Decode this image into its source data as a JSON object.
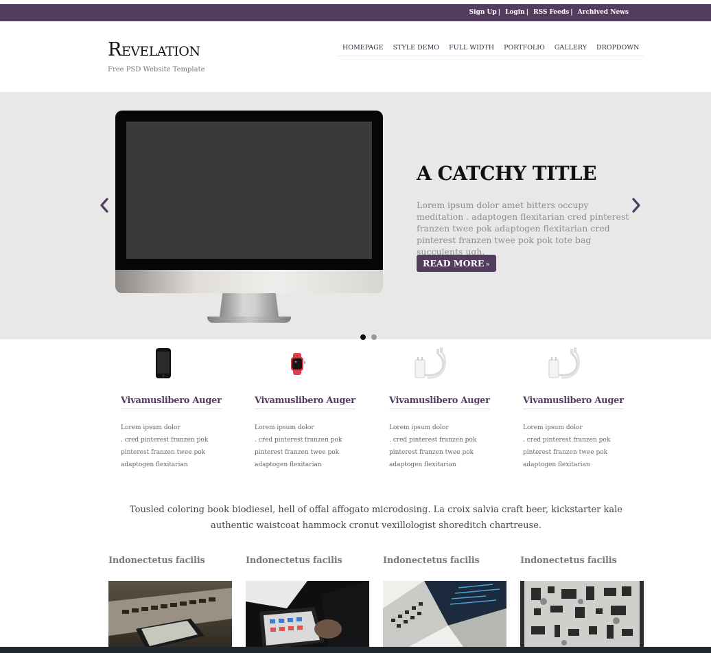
{
  "topbar": {
    "links": [
      "Sign Up",
      "Login",
      "RSS Feeds",
      "Archived News"
    ],
    "separator": "|",
    "bg_color": "#523d5e"
  },
  "header": {
    "logo": "Revelation",
    "tagline": "Free PSD Website Template"
  },
  "nav": {
    "items": [
      "HOMEPAGE",
      "STYLE DEMO",
      "FULL WIDTH",
      "PORTFOLIO",
      "GALLERY",
      "DROPDOWN"
    ]
  },
  "hero": {
    "title": "A CATCHY TITLE",
    "text": "Lorem ipsum dolor amet bitters occupy meditation . adaptogen flexitarian cred pinterest franzen twee pok adaptogen flexitarian cred pinterest franzen twee pok pok tote bag succulents ugh.",
    "button_label": "READ MORE",
    "button_suffix": "»",
    "prev_icon": "chevron-left-icon",
    "next_icon": "chevron-right-icon",
    "slides_total": 2,
    "active_slide": 1
  },
  "features": [
    {
      "icon": "smartphone-icon",
      "title": "Vivamuslibero Auger",
      "lines": [
        "Lorem ipsum dolor",
        ". cred pinterest franzen pok",
        "pinterest franzen twee pok",
        "adaptogen flexitarian"
      ]
    },
    {
      "icon": "smartwatch-icon",
      "title": "Vivamuslibero Auger",
      "lines": [
        "Lorem ipsum dolor",
        ". cred pinterest franzen pok",
        "pinterest franzen twee pok",
        "adaptogen flexitarian"
      ]
    },
    {
      "icon": "charger-icon",
      "title": "Vivamuslibero Auger",
      "lines": [
        "Lorem ipsum dolor",
        ". cred pinterest franzen pok",
        "pinterest franzen twee pok",
        "adaptogen flexitarian"
      ]
    },
    {
      "icon": "charger-icon",
      "title": "Vivamuslibero Auger",
      "lines": [
        "Lorem ipsum dolor",
        ". cred pinterest franzen pok",
        "pinterest franzen twee pok",
        "adaptogen flexitarian"
      ]
    }
  ],
  "quote": "Tousled coloring book biodiesel, hell of offal affogato microdosing. La croix salvia craft beer, kickstarter kale authentic waistcoat hammock cronut vexillologist shoreditch chartreuse.",
  "gallery": [
    {
      "title": "Indonectetus facilis",
      "image": "laptop-phone-photo"
    },
    {
      "title": "Indonectetus facilis",
      "image": "tablet-keyboard-photo"
    },
    {
      "title": "Indonectetus facilis",
      "image": "laptop-code-photo"
    },
    {
      "title": "Indonectetus facilis",
      "image": "flatlay-gadgets-photo"
    }
  ]
}
